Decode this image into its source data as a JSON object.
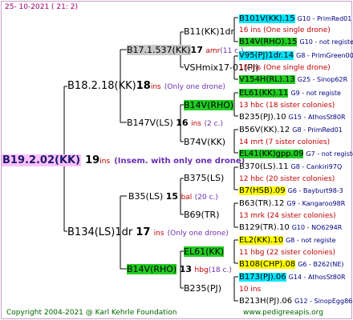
{
  "header": {
    "date": "25- 10-2021",
    "extra": "( 21:  2)"
  },
  "footer": {
    "copyright": "Copyright 2004-2021 @ Karl Kehrle Foundation",
    "url": "www.pedigreeapis.org"
  },
  "root": {
    "name": "B19.2.02(KK)",
    "num": "19",
    "ins": "ins",
    "note": "(Insem. with only one drone)"
  },
  "g1": [
    {
      "name": "B18.2.18(KK)",
      "num": "18",
      "ins": "ins",
      "note": "(Only one drone)"
    },
    {
      "name": "B134(LS)1dr",
      "num": "17",
      "ins": "ins",
      "note": "(Only one drone)"
    }
  ],
  "g2": [
    {
      "name": "B17.1.537(KK)",
      "num": "17",
      "ins": "amr",
      "note": "(11 c.)"
    },
    {
      "name": "B147V(LS)",
      "num": "16",
      "ins": "ins",
      "note": "(2 c.)"
    },
    {
      "name": "B35(LS)",
      "num": "15",
      "ins": "bal",
      "note": "(20 c.)"
    },
    {
      "name": "B14V(RHO)",
      "num": "13",
      "ins": "hbg",
      "note": "(18 c.)"
    }
  ],
  "g3": [
    {
      "name": "B11(KK)1dr",
      "num": "",
      "ins": "",
      "note": ""
    },
    {
      "name": "VSHmix17-01(PJ)",
      "num": "",
      "ins": "",
      "note": ""
    },
    {
      "name": "B14V(RHO)",
      "num": "",
      "ins": "",
      "note": ""
    },
    {
      "name": "B74V(KK)",
      "num": "",
      "ins": "",
      "note": ""
    },
    {
      "name": "B375(LS)",
      "num": "12",
      "ins": "hbc",
      "note": "(20 c.)"
    },
    {
      "name": "B69(TR)",
      "num": "",
      "ins": "",
      "note": ""
    },
    {
      "name": "EL61(KK)",
      "num": "",
      "ins": "",
      "note": ""
    },
    {
      "name": "B235(PJ)",
      "num": "",
      "ins": "",
      "note": ""
    }
  ],
  "g4": [
    {
      "name": "B101V(KK).15",
      "tag": "G10 - PrimRed01"
    },
    {
      "detail": "16 ins (One single drone)"
    },
    {
      "name": "B14V(RHO).15",
      "tag": "G10 - not registe"
    },
    {
      "name": "V95(PJ)1dr.14",
      "tag": "G8 - PrimGreen00"
    },
    {
      "detail": "15 ins (One single drone)"
    },
    {
      "name": "V154H(RL).13",
      "tag": "G25 - Sinop62R"
    },
    {
      "name": "EL61(KK).11",
      "tag": "G9 - not registe"
    },
    {
      "detail": "13 hbc (18 sister colonies)"
    },
    {
      "name": "B235(PJ).10",
      "tag": "G15 - AthosSt80R"
    },
    {
      "name": "B56V(KK).12",
      "tag": "G8 - PrimRed01"
    },
    {
      "detail": "14 mrt (7 sister colonies)"
    },
    {
      "name": "EL41(KK)gpp.09",
      "tag": "G7 - not registe"
    },
    {
      "name": "B370(LS).11",
      "tag": "G8 - Cankiri97Q"
    },
    {
      "detail": "12 hbc (20 sister colonies)"
    },
    {
      "name": "B7(HSB).09",
      "tag": "G6 - Bayburt98-3"
    },
    {
      "name": "B63(TR).12",
      "tag": "G9 - Kangaroo98R"
    },
    {
      "detail": "13 mrk (24 sister colonies)"
    },
    {
      "name": "B129(TR).10",
      "tag": "G10 - NO6294R"
    },
    {
      "name": "EL2(KK).10",
      "tag": "G8 - not registe"
    },
    {
      "detail": "11 hbg (22 sister colonies)"
    },
    {
      "name": "B108(CHP).08",
      "tag": "G6 - B262(NE)"
    },
    {
      "name": "B173(PJ).06",
      "tag": "G14 - AthosSt80R"
    },
    {
      "detail": "10 ins"
    },
    {
      "name": "B213H(PJ).06",
      "tag": "G12 - SinopEgg86R"
    }
  ],
  "colors": {
    "cyan": "#00e5ff",
    "green": "#22cc22",
    "yellow": "#ffff00",
    "pink": "#ffc0ff"
  }
}
